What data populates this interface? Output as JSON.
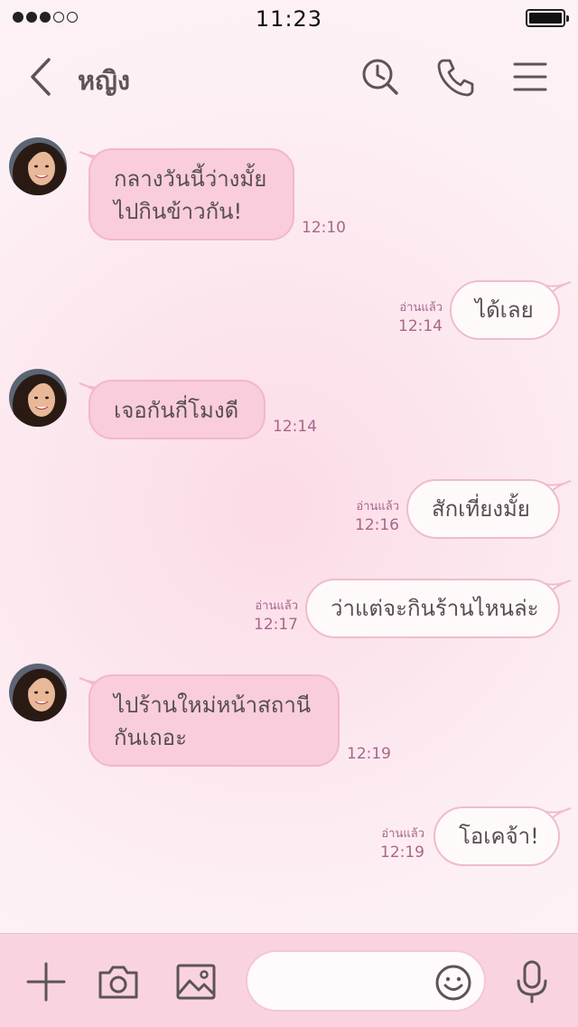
{
  "status_bar": {
    "time": "11:23",
    "signal_filled": 3,
    "signal_total": 5
  },
  "header": {
    "contact_name": "หญิง",
    "icons": [
      "back-chevron-icon",
      "history-clock-search-icon",
      "phone-icon",
      "menu-icon"
    ]
  },
  "messages": [
    {
      "direction": "in",
      "text_lines": [
        "กลางวันนี้ว่างมั้ย",
        "ไปกินข้าวกัน!"
      ],
      "time": "12:10"
    },
    {
      "direction": "out",
      "text_lines": [
        "ได้เลย"
      ],
      "read": "อ่านแล้ว",
      "time": "12:14"
    },
    {
      "direction": "in",
      "text_lines": [
        "เจอกันกี่โมงดี"
      ],
      "time": "12:14"
    },
    {
      "direction": "out",
      "text_lines": [
        "สักเที่ยงมั้ย"
      ],
      "read": "อ่านแล้ว",
      "time": "12:16"
    },
    {
      "direction": "out",
      "text_lines": [
        "ว่าแต่จะกินร้านไหนล่ะ"
      ],
      "read": "อ่านแล้ว",
      "time": "12:17"
    },
    {
      "direction": "in",
      "text_lines": [
        "ไปร้านใหม่หน้าสถานี",
        "กันเถอะ"
      ],
      "time": "12:19"
    },
    {
      "direction": "out",
      "text_lines": [
        "โอเคจ้า!"
      ],
      "read": "อ่านแล้ว",
      "time": "12:19"
    }
  ],
  "input_bar": {
    "placeholder": "",
    "icons": [
      "plus-icon",
      "camera-icon",
      "image-icon",
      "emoji-icon",
      "microphone-icon"
    ]
  },
  "colors": {
    "background": "#fdeef3",
    "incoming_bubble": "#f9cddc",
    "outgoing_bubble": "#fffafa",
    "timestamp": "#a8668a",
    "bottom_bar": "#f9d3e0"
  }
}
